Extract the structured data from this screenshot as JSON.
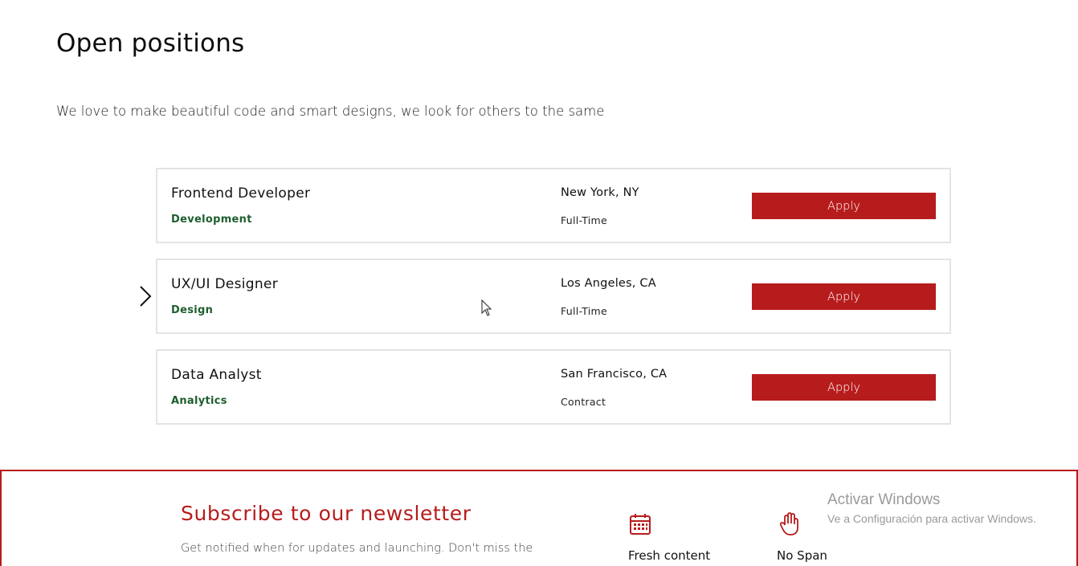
{
  "page": {
    "title": "Open positions",
    "intro": "We love to make beautiful code and smart designs, we look for others to the same"
  },
  "jobs": [
    {
      "title": "Frontend Developer",
      "department": "Development",
      "location": "New York, NY",
      "type": "Full-Time",
      "apply_label": "Apply"
    },
    {
      "title": "UX/UI Designer",
      "department": "Design",
      "location": "Los Angeles, CA",
      "type": "Full-Time",
      "apply_label": "Apply"
    },
    {
      "title": "Data Analyst",
      "department": "Analytics",
      "location": "San Francisco, CA",
      "type": "Contract",
      "apply_label": "Apply"
    }
  ],
  "newsletter": {
    "title": "Subscribe to our newsletter",
    "description": "Get notified when for updates and launching. Don't miss the",
    "features": [
      {
        "icon": "calendar-icon",
        "label": "Fresh content"
      },
      {
        "icon": "hand-icon",
        "label": "No Span"
      }
    ]
  },
  "watermark": {
    "title": "Activar Windows",
    "subtitle": "Ve a Configuración para activar Windows."
  },
  "colors": {
    "accent": "#b71c1c",
    "department": "#1e5e2e",
    "card_border": "#e4e4e4"
  },
  "icons": {
    "row_pointer": "chevron-right-icon",
    "cursor": "mouse-cursor-icon"
  }
}
